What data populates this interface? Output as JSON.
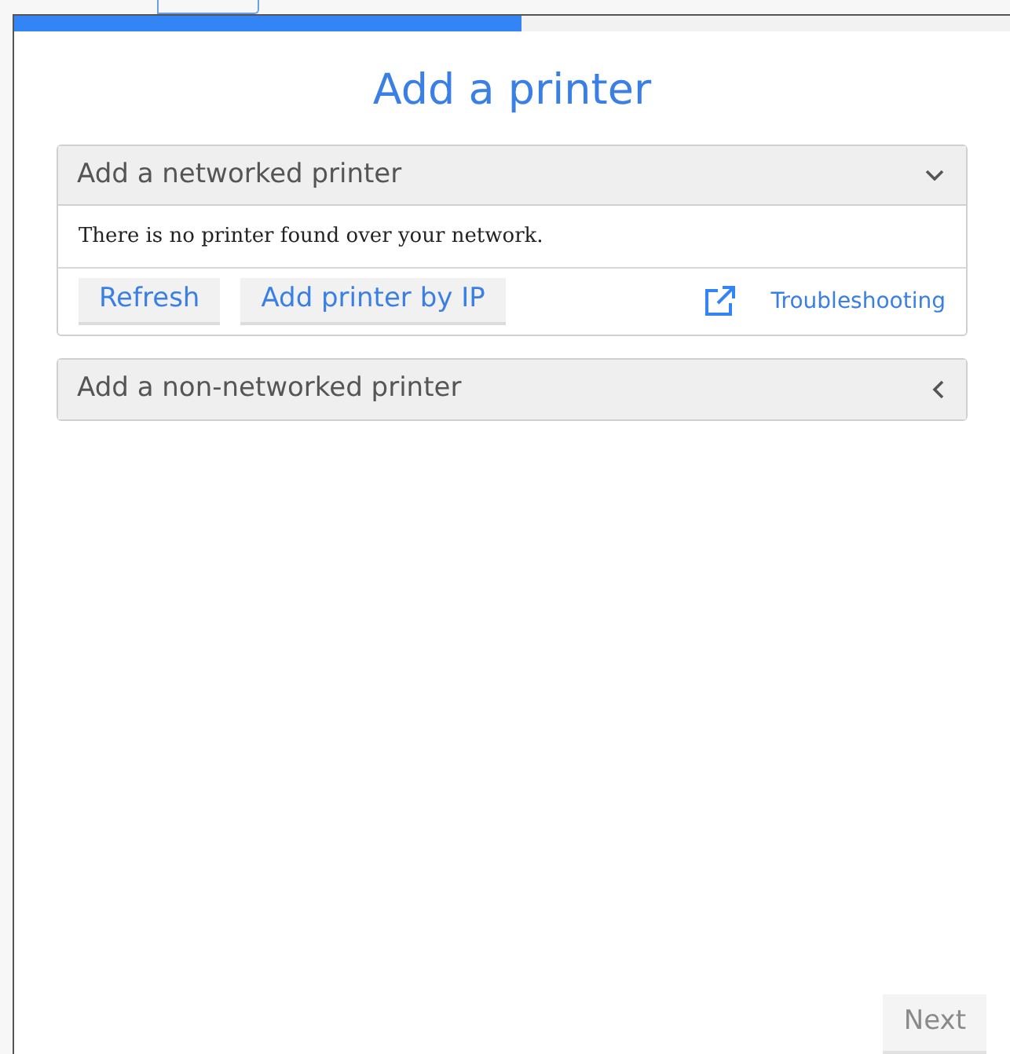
{
  "progress": {
    "level": 0.51
  },
  "title": "Add a printer",
  "sections": [
    {
      "title": "Add a networked printer",
      "expanded": true,
      "message": "There is no printer found over your network.",
      "buttons": [
        "Refresh",
        "Add printer by IP"
      ],
      "link": "Troubleshooting"
    },
    {
      "title": "Add a non-networked printer",
      "expanded": false
    }
  ],
  "next_button": {
    "label": "Next",
    "disabled": true
  }
}
